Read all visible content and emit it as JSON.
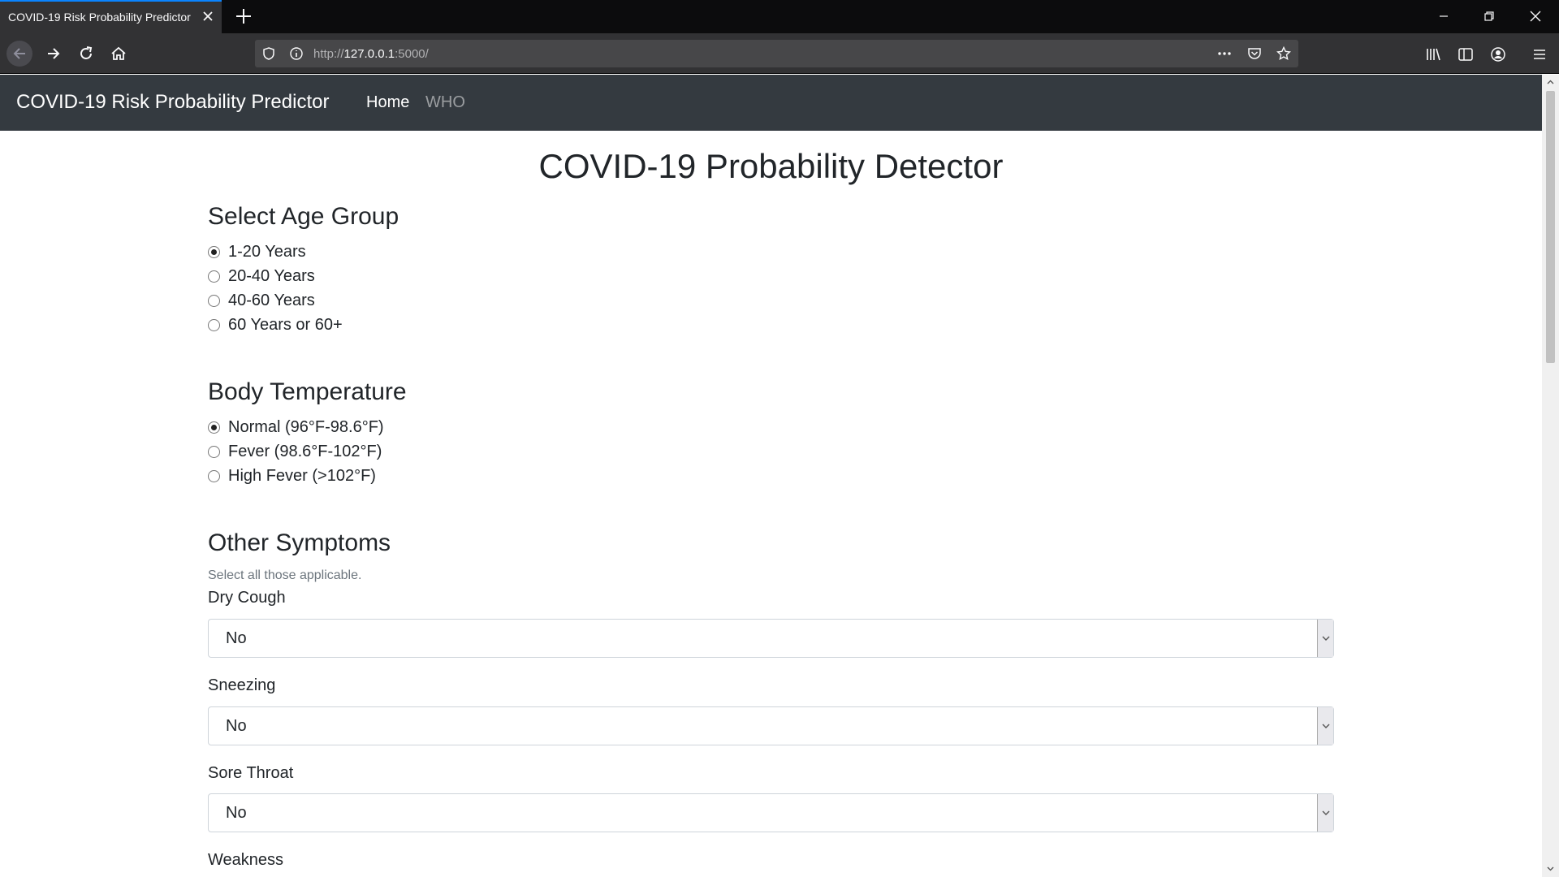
{
  "browser": {
    "tab_title": "COVID-19 Risk Probability Predictor",
    "url_prefix": "http://",
    "url_host": "127.0.0.1",
    "url_suffix": ":5000/"
  },
  "site": {
    "brand": "COVID-19 Risk Probability Predictor",
    "nav": {
      "home": "Home",
      "who": "WHO"
    }
  },
  "page": {
    "title": "COVID-19 Probability Detector",
    "age": {
      "heading": "Select Age Group",
      "options": [
        "1-20 Years",
        "20-40 Years",
        "40-60 Years",
        "60 Years or 60+"
      ],
      "selected_index": 0
    },
    "temperature": {
      "heading": "Body Temperature",
      "options": [
        "Normal (96°F-98.6°F)",
        "Fever (98.6°F-102°F)",
        "High Fever (>102°F)"
      ],
      "selected_index": 0
    },
    "symptoms": {
      "heading": "Other Symptoms",
      "help": "Select all those applicable.",
      "fields": [
        {
          "label": "Dry Cough",
          "value": "No"
        },
        {
          "label": "Sneezing",
          "value": "No"
        },
        {
          "label": "Sore Throat",
          "value": "No"
        },
        {
          "label": "Weakness"
        }
      ]
    }
  },
  "colors": {
    "site_nav_bg": "#343a40",
    "browser_accent": "#0a84ff"
  }
}
